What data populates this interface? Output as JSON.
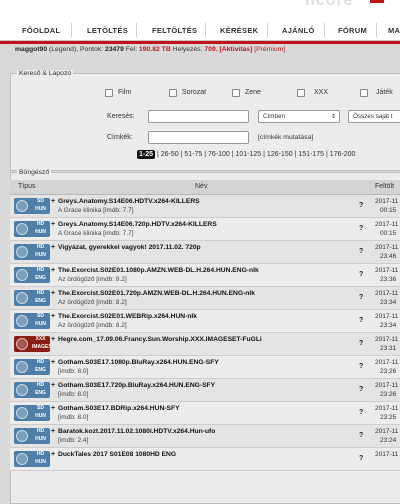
{
  "colors": {
    "accent": "#c0161b",
    "thumb_blue": "#4f7fa8",
    "thumb_xxx": "#8a1d14"
  },
  "nav": [
    "FŐOLDAL",
    "LETÖLTÉS",
    "FELTÖLTÉS",
    "KÉRÉSEK",
    "AJÁNLÓ",
    "FÓRUM",
    "MAN"
  ],
  "user": {
    "name": "maggot90",
    "role": "(Legend)",
    "points_label": "Pontok:",
    "points": "23479",
    "upload_label": "Fel:",
    "upload": "190.82 TB",
    "rank_label": "Helyezés:",
    "rank": "709.",
    "activity": "[Aktivitás]",
    "premium": "[Prémium]"
  },
  "search": {
    "title": "Kereső & Lapozó",
    "categories": [
      "Film",
      "Sorozat",
      "Zene",
      "XXX",
      "Játék"
    ],
    "search_label": "Keresés:",
    "search_value": "",
    "field_select": "Címben",
    "type_select": "Összes saját t",
    "tags_label": "Címkék:",
    "tags_value": "",
    "tags_hint": "[címkék mutatása]"
  },
  "pager": {
    "current": "1-25",
    "pages": [
      "26-50",
      "51-75",
      "76-100",
      "101-125",
      "126-150",
      "151-175",
      "176-200"
    ]
  },
  "browser": {
    "title": "Böngésző",
    "col_type": "Típus",
    "col_name": "Név",
    "col_uploaded": "Feltölt"
  },
  "torrents": [
    {
      "thumb_top": "SD",
      "thumb_bottom": "HUN",
      "xxx": false,
      "title": "Greys.Anatomy.S14E06.HDTV.x264-KILLERS",
      "sub": "A Grace klinika [imdb: 7.7]",
      "date": "2017-11",
      "time": "00:15"
    },
    {
      "thumb_top": "HD",
      "thumb_bottom": "HUN",
      "xxx": false,
      "title": "Greys.Anatomy.S14E06.720p.HDTV.x264-KILLERS",
      "sub": "A Grace klinika [imdb: 7.7]",
      "date": "2017-11",
      "time": "00:15"
    },
    {
      "thumb_top": "HD",
      "thumb_bottom": "HUN",
      "xxx": false,
      "title": "Vigyázat, gyerekkel vagyok! 2017.11.02. 720p",
      "sub": "",
      "date": "2017-11",
      "time": "23:46"
    },
    {
      "thumb_top": "HD",
      "thumb_bottom": "ENG",
      "xxx": false,
      "title": "The.Exorcist.S02E01.1080p.AMZN.WEB-DL.H.264.HUN.ENG-nIk",
      "sub": "Az ördögűző [imdb: 8.2]",
      "date": "2017-11",
      "time": "23:36"
    },
    {
      "thumb_top": "HD",
      "thumb_bottom": "ENG",
      "xxx": false,
      "title": "The.Exorcist.S02E01.720p.AMZN.WEB-DL.H.264.HUN.ENG-nIk",
      "sub": "Az ördögűző [imdb: 8.2]",
      "date": "2017-11",
      "time": "23:34"
    },
    {
      "thumb_top": "SD",
      "thumb_bottom": "HUN",
      "xxx": false,
      "title": "The.Exorcist.S02E01.WEBRip.x264.HUN-nIk",
      "sub": "Az ördögűző [imdb: 8.2]",
      "date": "2017-11",
      "time": "23:34"
    },
    {
      "thumb_top": "XXX",
      "thumb_bottom": "IMAGESET",
      "xxx": true,
      "title": "Hegre.com_17.09.06.Francy.Sun.Worship.XXX.IMAGESET-FuGLi",
      "sub": "",
      "date": "2017-11",
      "time": "23:31"
    },
    {
      "thumb_top": "HD",
      "thumb_bottom": "ENG",
      "xxx": false,
      "title": "Gotham.S03E17.1080p.BluRay.x264.HUN.ENG-SFY",
      "sub": "[imdb: 8.0]",
      "date": "2017-11",
      "time": "23:26"
    },
    {
      "thumb_top": "HD",
      "thumb_bottom": "ENG",
      "xxx": false,
      "title": "Gotham.S03E17.720p.BluRay.x264.HUN.ENG-SFY",
      "sub": "[imdb: 8.0]",
      "date": "2017-11",
      "time": "23:26"
    },
    {
      "thumb_top": "SD",
      "thumb_bottom": "HUN",
      "xxx": false,
      "title": "Gotham.S03E17.BDRip.x264.HUN-SFY",
      "sub": "[imdb: 8.0]",
      "date": "2017-11",
      "time": "23:25"
    },
    {
      "thumb_top": "HD",
      "thumb_bottom": "HUN",
      "xxx": false,
      "title": "Baratok.kozt.2017.11.02.1080i.HDTV.x264.Hun-ufo",
      "sub": "[imdb: 2.4]",
      "date": "2017-11",
      "time": "23:24"
    },
    {
      "thumb_top": "HD",
      "thumb_bottom": "HUN",
      "xxx": false,
      "title": "DuckTales 2017 S01E08 1080HD ENG",
      "sub": "",
      "date": "2017-11",
      "time": ""
    }
  ]
}
